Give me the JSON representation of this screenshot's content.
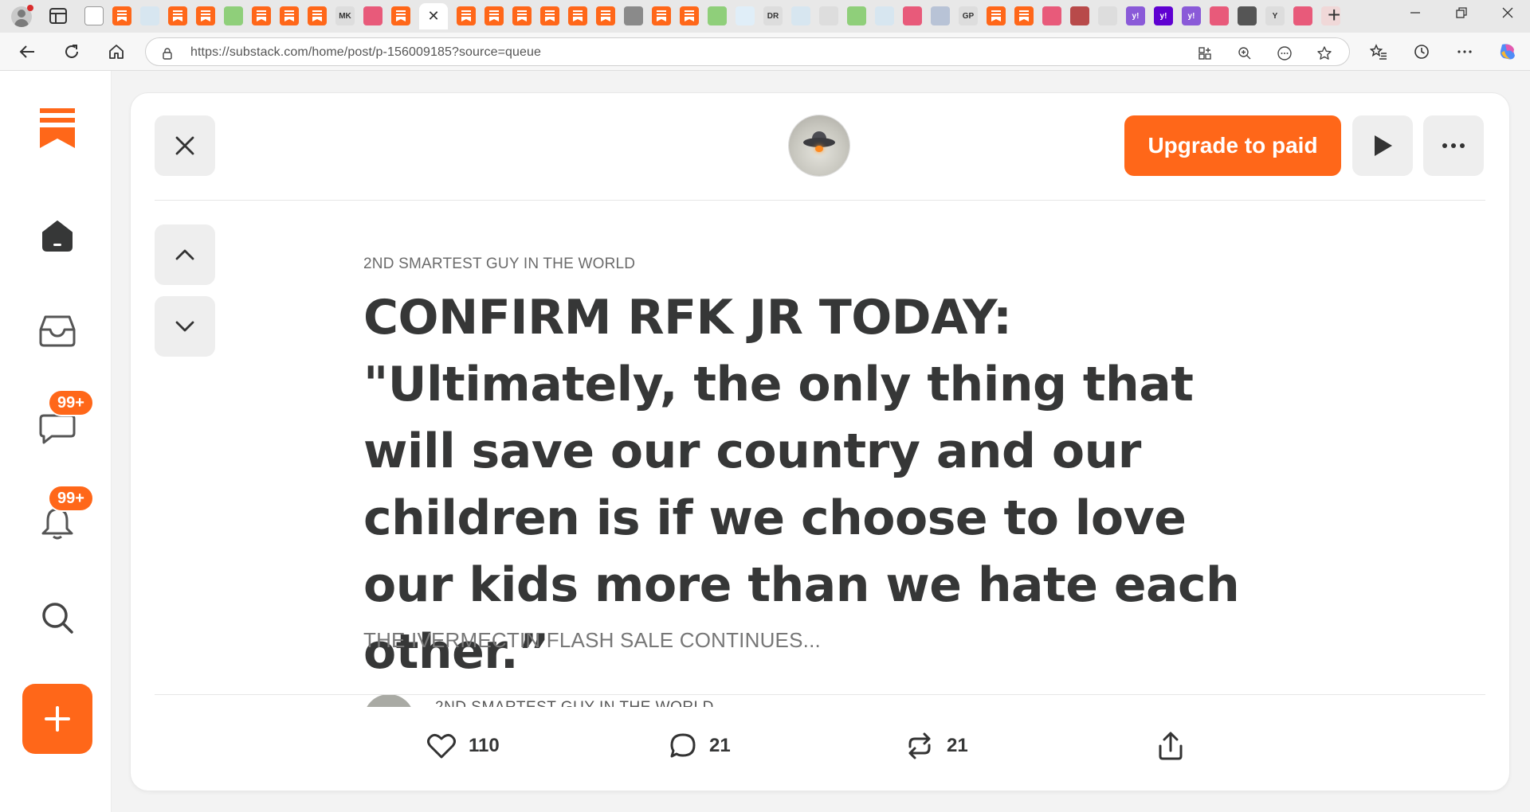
{
  "browser": {
    "url": "https://substack.com/home/post/p-156009185?source=queue",
    "active_tab_close": "✕",
    "new_tab": "+",
    "tab_favicons": [
      {
        "icon": "page-icon",
        "color": "#ffffff",
        "text": ""
      },
      {
        "icon": "substack-icon",
        "color": "#ff6719",
        "text": ""
      },
      {
        "icon": "health-icon",
        "color": "#d7e6f0",
        "text": ""
      },
      {
        "icon": "substack-icon",
        "color": "#ff6719",
        "text": ""
      },
      {
        "icon": "substack-icon",
        "color": "#ff6719",
        "text": ""
      },
      {
        "icon": "play-icon",
        "color": "#8fcf7a",
        "text": ""
      },
      {
        "icon": "substack-icon",
        "color": "#ff6719",
        "text": ""
      },
      {
        "icon": "substack-icon",
        "color": "#ff6719",
        "text": ""
      },
      {
        "icon": "substack-icon",
        "color": "#ff6719",
        "text": ""
      },
      {
        "icon": "mk-icon",
        "color": "#dddddd",
        "text": "MK"
      },
      {
        "icon": "youtube-icon",
        "color": "#e85a7a",
        "text": ""
      },
      {
        "icon": "substack-icon",
        "color": "#ff6719",
        "text": ""
      },
      {
        "icon": "substack-icon",
        "color": "#ff6719",
        "text": ""
      },
      {
        "icon": "substack-icon",
        "color": "#ff6719",
        "text": ""
      },
      {
        "icon": "substack-icon",
        "color": "#ff6719",
        "text": ""
      },
      {
        "icon": "substack-icon",
        "color": "#ff6719",
        "text": ""
      },
      {
        "icon": "substack-icon",
        "color": "#ff6719",
        "text": ""
      },
      {
        "icon": "substack-icon",
        "color": "#ff6719",
        "text": ""
      },
      {
        "icon": "photo-icon",
        "color": "#8a8a8a",
        "text": ""
      },
      {
        "icon": "substack-icon",
        "color": "#ff6719",
        "text": ""
      },
      {
        "icon": "substack-icon",
        "color": "#ff6719",
        "text": ""
      },
      {
        "icon": "play-icon",
        "color": "#8fcf7a",
        "text": ""
      },
      {
        "icon": "search-icon",
        "color": "#e0eef8",
        "text": ""
      },
      {
        "icon": "dr-icon",
        "color": "#dddddd",
        "text": "DR"
      },
      {
        "icon": "health-icon",
        "color": "#d7e6f0",
        "text": ""
      },
      {
        "icon": "bird-icon",
        "color": "#dddddd",
        "text": ""
      },
      {
        "icon": "play-icon",
        "color": "#8fcf7a",
        "text": ""
      },
      {
        "icon": "health-icon",
        "color": "#d7e6f0",
        "text": ""
      },
      {
        "icon": "youtube-icon",
        "color": "#e85a7a",
        "text": ""
      },
      {
        "icon": "news-icon",
        "color": "#b8c3d6",
        "text": ""
      },
      {
        "icon": "gp-icon",
        "color": "#dddddd",
        "text": "GP"
      },
      {
        "icon": "substack-icon",
        "color": "#ff6719",
        "text": ""
      },
      {
        "icon": "substack-icon",
        "color": "#ff6719",
        "text": ""
      },
      {
        "icon": "youtube-icon",
        "color": "#e85a7a",
        "text": ""
      },
      {
        "icon": "book-icon",
        "color": "#b84a4a",
        "text": ""
      },
      {
        "icon": "bird-icon",
        "color": "#dddddd",
        "text": ""
      },
      {
        "icon": "yahoo-icon",
        "color": "#8a5ad8",
        "text": "y!"
      },
      {
        "icon": "yahoo-icon",
        "color": "#5f01d1",
        "text": "y!"
      },
      {
        "icon": "yahoo-icon",
        "color": "#8a5ad8",
        "text": "y!"
      },
      {
        "icon": "youtube-icon",
        "color": "#e85a7a",
        "text": ""
      },
      {
        "icon": "circle-icon",
        "color": "#555555",
        "text": ""
      },
      {
        "icon": "y-icon",
        "color": "#dddddd",
        "text": "Y"
      },
      {
        "icon": "youtube-icon",
        "color": "#e85a7a",
        "text": ""
      },
      {
        "icon": "feather-icon",
        "color": "#f0d8d8",
        "text": ""
      }
    ]
  },
  "sidebar": {
    "messages_badge": "99+",
    "notifications_badge": "99+"
  },
  "post": {
    "publication": "2ND SMARTEST GUY IN THE WORLD",
    "title": "CONFIRM RFK JR TODAY: \"Ultimately, the only thing that will save our country and our children is if we choose to love our kids more than we hate each other.”",
    "subtitle": "THE IVERMECTIN FLASH SALE CONTINUES...",
    "byline": "2ND SMARTEST GUY IN THE WORLD",
    "upgrade_label": "Upgrade to paid"
  },
  "actions": {
    "likes": "110",
    "comments": "21",
    "restacks": "21"
  },
  "colors": {
    "accent": "#ff6719",
    "text": "#363737"
  }
}
